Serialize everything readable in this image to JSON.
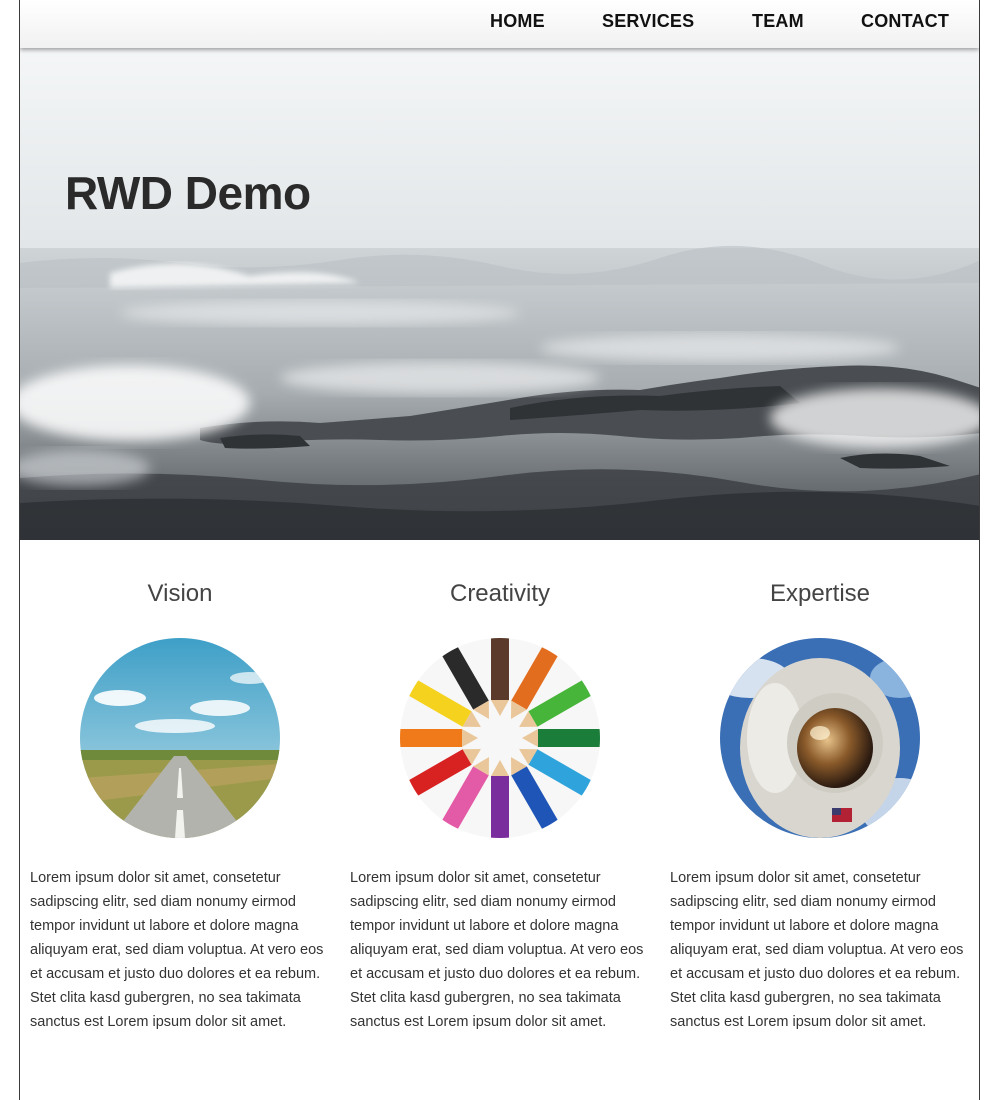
{
  "nav": {
    "items": [
      {
        "label": "HOME"
      },
      {
        "label": "SERVICES"
      },
      {
        "label": "TEAM"
      },
      {
        "label": "CONTACT"
      }
    ]
  },
  "hero": {
    "title": "RWD Demo",
    "image": "ocean-waves-on-rocks"
  },
  "features": [
    {
      "title": "Vision",
      "image": "country-road",
      "text": "Lorem ipsum dolor sit amet, consetetur sadipsc­ing elitr, sed diam nonumy eirmod tempor invi­dunt ut labore et dolore magna aliquyam erat, sed diam voluptua. At vero eos et accusam et justo duo dolores et ea rebum. Stet clita kasd gubergren, no sea takimata sanctus est Lorem ipsum dolor sit amet."
    },
    {
      "title": "Creativity",
      "image": "colored-pencils",
      "text": "Lorem ipsum dolor sit amet, consetetur sadipsc­ing elitr, sed diam nonumy eirmod tempor invi­dunt ut labore et dolore magna aliquyam erat, sed diam voluptua. At vero eos et accusam et justo duo dolores et ea rebum. Stet clita kasd gubergren, no sea takimata sanctus est Lorem ipsum dolor sit amet."
    },
    {
      "title": "Expertise",
      "image": "astronaut",
      "text": "Lorem ipsum dolor sit amet, consetetur sadipsc­ing elitr, sed diam nonumy eirmod tempor invi­dunt ut labore et dolore magna aliquyam erat, sed diam voluptua. At vero eos et accusam et justo duo dolores et ea rebum. Stet clita kasd gubergren, no sea takimata sanctus est Lorem ipsum dolor sit amet."
    }
  ]
}
